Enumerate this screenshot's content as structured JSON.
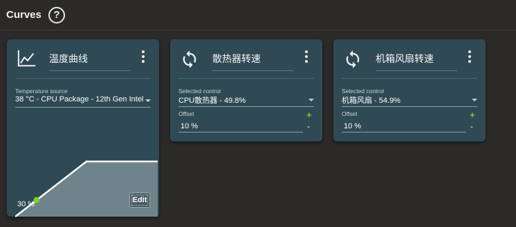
{
  "header": {
    "title": "Curves",
    "help_label": "?"
  },
  "cards": [
    {
      "name": "温度曲线",
      "icon": "chart-line-icon",
      "source_label": "Temperature source",
      "source_value": "38 °C - CPU Package - 12th Gen Intel",
      "current_value": "30 %",
      "edit_label": "Edit",
      "curve_points": [
        {
          "temperature": 0,
          "speed": 0
        },
        {
          "temperature": 50,
          "speed": 100
        },
        {
          "temperature": 100,
          "speed": 100
        }
      ],
      "current_point": {
        "temperature": 15,
        "speed": 30
      }
    },
    {
      "name": "散热器转速",
      "icon": "sync-icon",
      "control_label": "Selected control",
      "control_value": "CPU散热器 - 49.8%",
      "offset_label": "Offset",
      "offset_value": "10 %",
      "plus_label": "+",
      "minus_label": "-"
    },
    {
      "name": "机箱风扇转速",
      "icon": "sync-icon",
      "control_label": "Selected control",
      "control_value": "机箱风扇 - 54.9%",
      "offset_label": "Offset",
      "offset_value": "10 %",
      "plus_label": "+",
      "minus_label": "-"
    }
  ],
  "colors": {
    "background": "#2b2a29",
    "card": "#2f4a55",
    "accent_green": "#7ad12c",
    "curve_fill": "#6f838a"
  }
}
